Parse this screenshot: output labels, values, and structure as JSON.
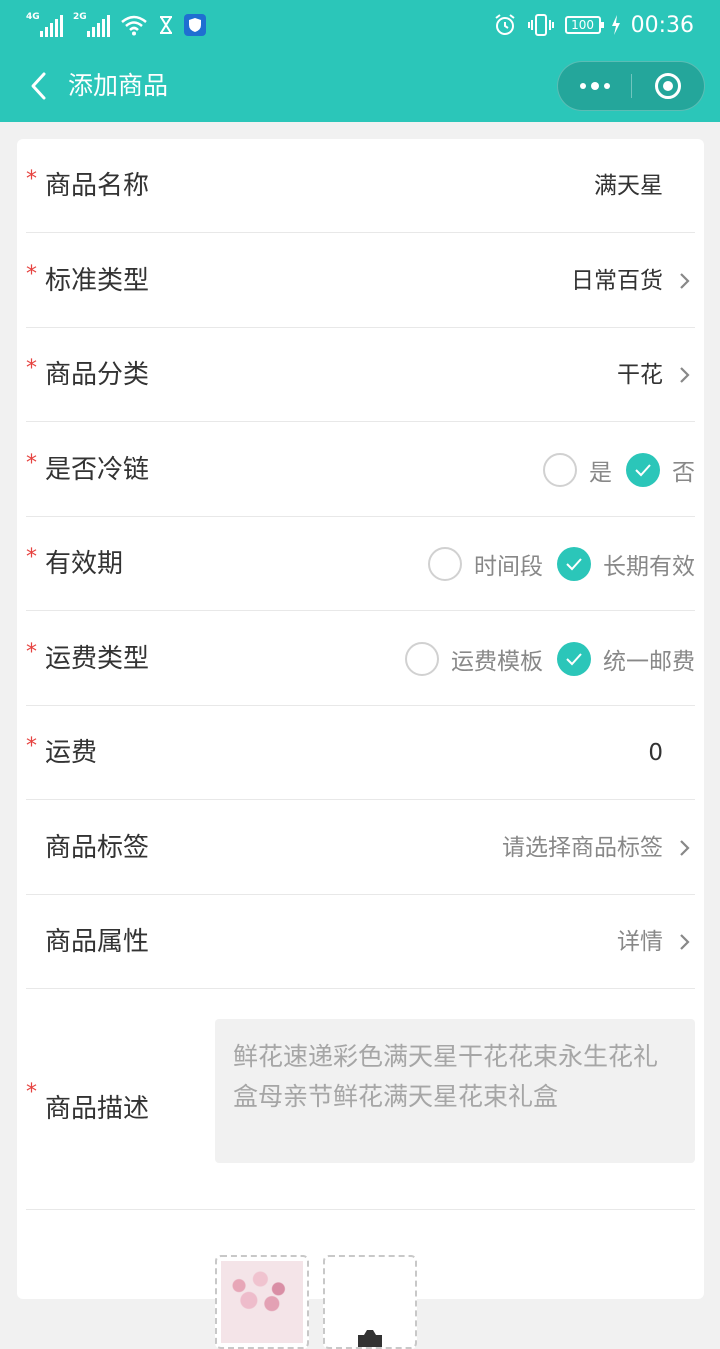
{
  "statusbar": {
    "network_1": "4G",
    "network_2": "2G",
    "battery": "100",
    "time": "00:36"
  },
  "navbar": {
    "title": "添加商品"
  },
  "form": {
    "name": {
      "label": "商品名称",
      "value": "满天星"
    },
    "standard_type": {
      "label": "标准类型",
      "value": "日常百货"
    },
    "category": {
      "label": "商品分类",
      "value": "干花"
    },
    "cold_chain": {
      "label": "是否冷链",
      "option_yes": "是",
      "option_no": "否",
      "selected": "否"
    },
    "validity": {
      "label": "有效期",
      "option_period": "时间段",
      "option_long": "长期有效",
      "selected": "长期有效"
    },
    "shipping_type": {
      "label": "运费类型",
      "option_template": "运费模板",
      "option_unified": "统一邮费",
      "selected": "统一邮费"
    },
    "shipping_fee": {
      "label": "运费",
      "value": "0"
    },
    "tags": {
      "label": "商品标签",
      "placeholder": "请选择商品标签"
    },
    "attributes": {
      "label": "商品属性",
      "value": "详情"
    },
    "description": {
      "label": "商品描述",
      "value": "鲜花速递彩色满天星干花花束永生花礼盒母亲节鲜花满天星花束礼盒"
    }
  },
  "colors": {
    "accent": "#2bc6b9",
    "required": "#e64340",
    "label": "#333333",
    "muted": "#888888"
  },
  "icons": [
    "signal-icon",
    "wifi-icon",
    "hourglass-icon",
    "shield-icon",
    "alarm-icon",
    "vibrate-icon",
    "battery-icon",
    "charging-icon",
    "back-icon",
    "more-icon",
    "close-target-icon",
    "chevron-right-icon",
    "check-icon",
    "camera-icon"
  ]
}
